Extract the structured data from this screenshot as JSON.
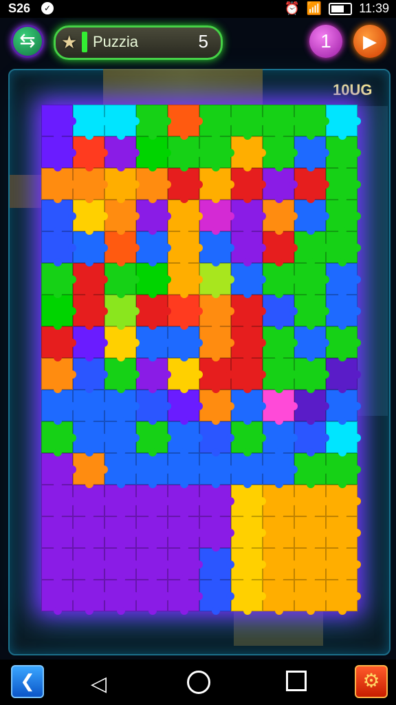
{
  "status": {
    "left_text": "S26",
    "time": "11:39"
  },
  "header": {
    "title": "Puzzia",
    "count": "5",
    "hint_count": "1"
  },
  "board": {
    "score": "10UG",
    "rows": [
      [
        "#6a1cff",
        "#00e5ff",
        "#00e5ff",
        "#16d116",
        "#ff5a10",
        "#16d116",
        "#16d116",
        "#16d116",
        "#16d116",
        "#00e5ff"
      ],
      [
        "#6a1cff",
        "#ff3b1f",
        "#8a1ce6",
        "#00d400",
        "#16d116",
        "#16d116",
        "#ffae00",
        "#16d116",
        "#1e6aff",
        "#16d116"
      ],
      [
        "#ff8c10",
        "#ff8c10",
        "#ffae00",
        "#ff8c10",
        "#e61e1e",
        "#ffae00",
        "#e61e1e",
        "#8a1ce6",
        "#e61e1e",
        "#16d116"
      ],
      [
        "#2b56ff",
        "#ffd000",
        "#ff8c10",
        "#8a1ce6",
        "#ffae00",
        "#d42ad4",
        "#8a1ce6",
        "#ff8c10",
        "#1e6aff",
        "#16d116"
      ],
      [
        "#2b56ff",
        "#1e6aff",
        "#ff5a10",
        "#1e6aff",
        "#ffae00",
        "#1e6aff",
        "#8a1ce6",
        "#e61e1e",
        "#16d116",
        "#16d116"
      ],
      [
        "#16d116",
        "#e61e1e",
        "#16d116",
        "#00d400",
        "#ffae00",
        "#a8e61e",
        "#1e6aff",
        "#16d116",
        "#16d116",
        "#1e6aff"
      ],
      [
        "#00d400",
        "#e61e1e",
        "#8ae61e",
        "#e61e1e",
        "#ff3b1f",
        "#ff8c10",
        "#e61e1e",
        "#2b56ff",
        "#16d116",
        "#1e6aff"
      ],
      [
        "#e61e1e",
        "#6a1cff",
        "#ffd000",
        "#1e6aff",
        "#1e6aff",
        "#ff8c10",
        "#e61e1e",
        "#16d116",
        "#1e6aff",
        "#16d116"
      ],
      [
        "#ff8c10",
        "#2b56ff",
        "#16d116",
        "#8a1ce6",
        "#ffd000",
        "#e61e1e",
        "#e61e1e",
        "#16d116",
        "#16d116",
        "#5a1cc8"
      ],
      [
        "#1e6aff",
        "#1e6aff",
        "#1e6aff",
        "#2b56ff",
        "#6a1cff",
        "#ff8c10",
        "#1e6aff",
        "#ff4ad8",
        "#5a1cc8",
        "#1e6aff"
      ],
      [
        "#16d116",
        "#1e6aff",
        "#1e6aff",
        "#16d116",
        "#1e6aff",
        "#2b56ff",
        "#16d116",
        "#1e6aff",
        "#2b56ff",
        "#00e5ff"
      ],
      [
        "#8a1ce6",
        "#ff8c10",
        "#1e6aff",
        "#1e6aff",
        "#1e6aff",
        "#1e6aff",
        "#1e6aff",
        "#1e6aff",
        "#16d116",
        "#16d116"
      ],
      [
        "#8a1ce6",
        "#8a1ce6",
        "#8a1ce6",
        "#8a1ce6",
        "#8a1ce6",
        "#8a1ce6",
        "#ffd000",
        "#ffae00",
        "#ffae00",
        "#ffae00"
      ],
      [
        "#8a1ce6",
        "#8a1ce6",
        "#8a1ce6",
        "#8a1ce6",
        "#8a1ce6",
        "#8a1ce6",
        "#ffd000",
        "#ffae00",
        "#ffae00",
        "#ffae00"
      ],
      [
        "#8a1ce6",
        "#8a1ce6",
        "#8a1ce6",
        "#8a1ce6",
        "#8a1ce6",
        "#2b56ff",
        "#ffd000",
        "#ffae00",
        "#ffae00",
        "#ffae00"
      ],
      [
        "#8a1ce6",
        "#8a1ce6",
        "#8a1ce6",
        "#8a1ce6",
        "#8a1ce6",
        "#2b56ff",
        "#ffd000",
        "#ffae00",
        "#ffae00",
        "#ffae00"
      ]
    ]
  },
  "icons": {
    "back": "back-arrow-icon",
    "star": "star-icon",
    "play": "play-icon",
    "nav_back": "chevron-left-icon",
    "nav_tri": "triangle-back-icon",
    "nav_home": "circle-home-icon",
    "nav_recents": "square-recents-icon",
    "settings": "gear-icon"
  },
  "accent": {
    "green": "#46d246",
    "purple": "#9b39ff",
    "orange": "#ff7a00"
  }
}
